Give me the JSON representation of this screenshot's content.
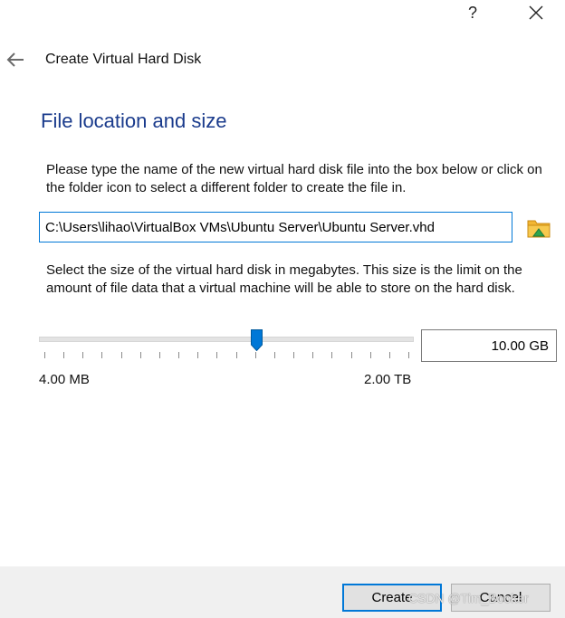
{
  "titlebar": {
    "help_label": "?",
    "close_icon": "close-icon"
  },
  "header": {
    "back_icon": "back-arrow-icon",
    "title": "Create Virtual Hard Disk"
  },
  "section_title": "File location and size",
  "location": {
    "description": "Please type the name of the new virtual hard disk file into the box below or click on the folder icon to select a different folder to create the file in.",
    "path_value": "C:\\Users\\lihao\\VirtualBox VMs\\Ubuntu Server\\Ubuntu Server.vhd",
    "folder_icon": "folder-icon"
  },
  "size": {
    "description": "Select the size of the virtual hard disk in megabytes. This size is the limit on the amount of file data that a virtual machine will be able to store on the hard disk.",
    "value": "10.00 GB",
    "min_label": "4.00 MB",
    "max_label": "2.00 TB",
    "slider_fraction": 0.583,
    "tick_count": 20
  },
  "footer": {
    "create_label": "Create",
    "cancel_label": "Cancel"
  },
  "watermark": "CSDN @Tim_Booker",
  "colors": {
    "accent": "#0078d7",
    "section_title": "#1a3b8c",
    "footer_bg": "#f0f0f0"
  }
}
